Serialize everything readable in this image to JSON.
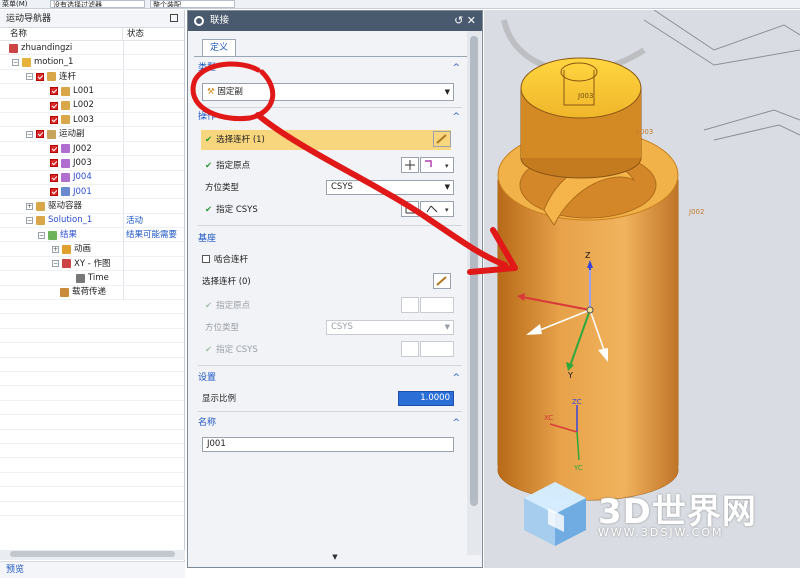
{
  "toolbar": {
    "item1": "菜单(M)",
    "item2": "没有选择过滤器",
    "item3": "整个装配"
  },
  "navigator": {
    "title": "运动导航器",
    "col_name": "名称",
    "col_status": "状态",
    "rows": [
      {
        "label": "zhuandingzi",
        "status": ""
      },
      {
        "label": "motion_1",
        "status": ""
      },
      {
        "label": "连杆",
        "status": ""
      },
      {
        "label": "L001",
        "status": ""
      },
      {
        "label": "L002",
        "status": ""
      },
      {
        "label": "L003",
        "status": ""
      },
      {
        "label": "运动副",
        "status": ""
      },
      {
        "label": "J002",
        "status": ""
      },
      {
        "label": "J003",
        "status": ""
      },
      {
        "label": "J004",
        "status": ""
      },
      {
        "label": "J001",
        "status": ""
      },
      {
        "label": "驱动容器",
        "status": ""
      },
      {
        "label": "Solution_1",
        "status": "活动"
      },
      {
        "label": "结果",
        "status": "结果可能需要"
      },
      {
        "label": "动画",
        "status": ""
      },
      {
        "label": "XY - 作图",
        "status": ""
      },
      {
        "label": "Time",
        "status": ""
      },
      {
        "label": "载荷传递",
        "status": ""
      }
    ],
    "preview_label": "预览"
  },
  "dialog": {
    "title": "联接",
    "tab_define": "定义",
    "type_section": "类型",
    "type_value": "固定副",
    "action_section": "操作",
    "select_link": "选择连杆 (1)",
    "specify_origin": "指定原点",
    "orientation_type": "方位类型",
    "orientation_value": "CSYS",
    "specify_csys": "指定 CSYS",
    "base_section": "基座",
    "snap_link": "啮合连杆",
    "select_link_base": "选择连杆 (0)",
    "specify_origin_base": "指定原点",
    "orientation_type_base": "方位类型",
    "orientation_value_base": "CSYS",
    "specify_csys_base": "指定 CSYS",
    "settings_section": "设置",
    "display_scale_label": "显示比例",
    "display_scale_value": "1.0000",
    "name_section": "名称",
    "name_value": "J001"
  },
  "viewport": {
    "labels": [
      "J003",
      "J002",
      "L003",
      "Z",
      "Y",
      "ZC",
      "XC",
      "YC"
    ]
  },
  "watermark": {
    "brand": "3D世界网",
    "url": "WWW.3DSJW.COM"
  },
  "colors": {
    "part_body": "#e0a04a",
    "part_top": "#f5c33a",
    "annotation_red": "#e01818",
    "highlight": "#f7d67d",
    "dialog_header": "#4a5a6e",
    "link_blue": "#1d56c4"
  }
}
